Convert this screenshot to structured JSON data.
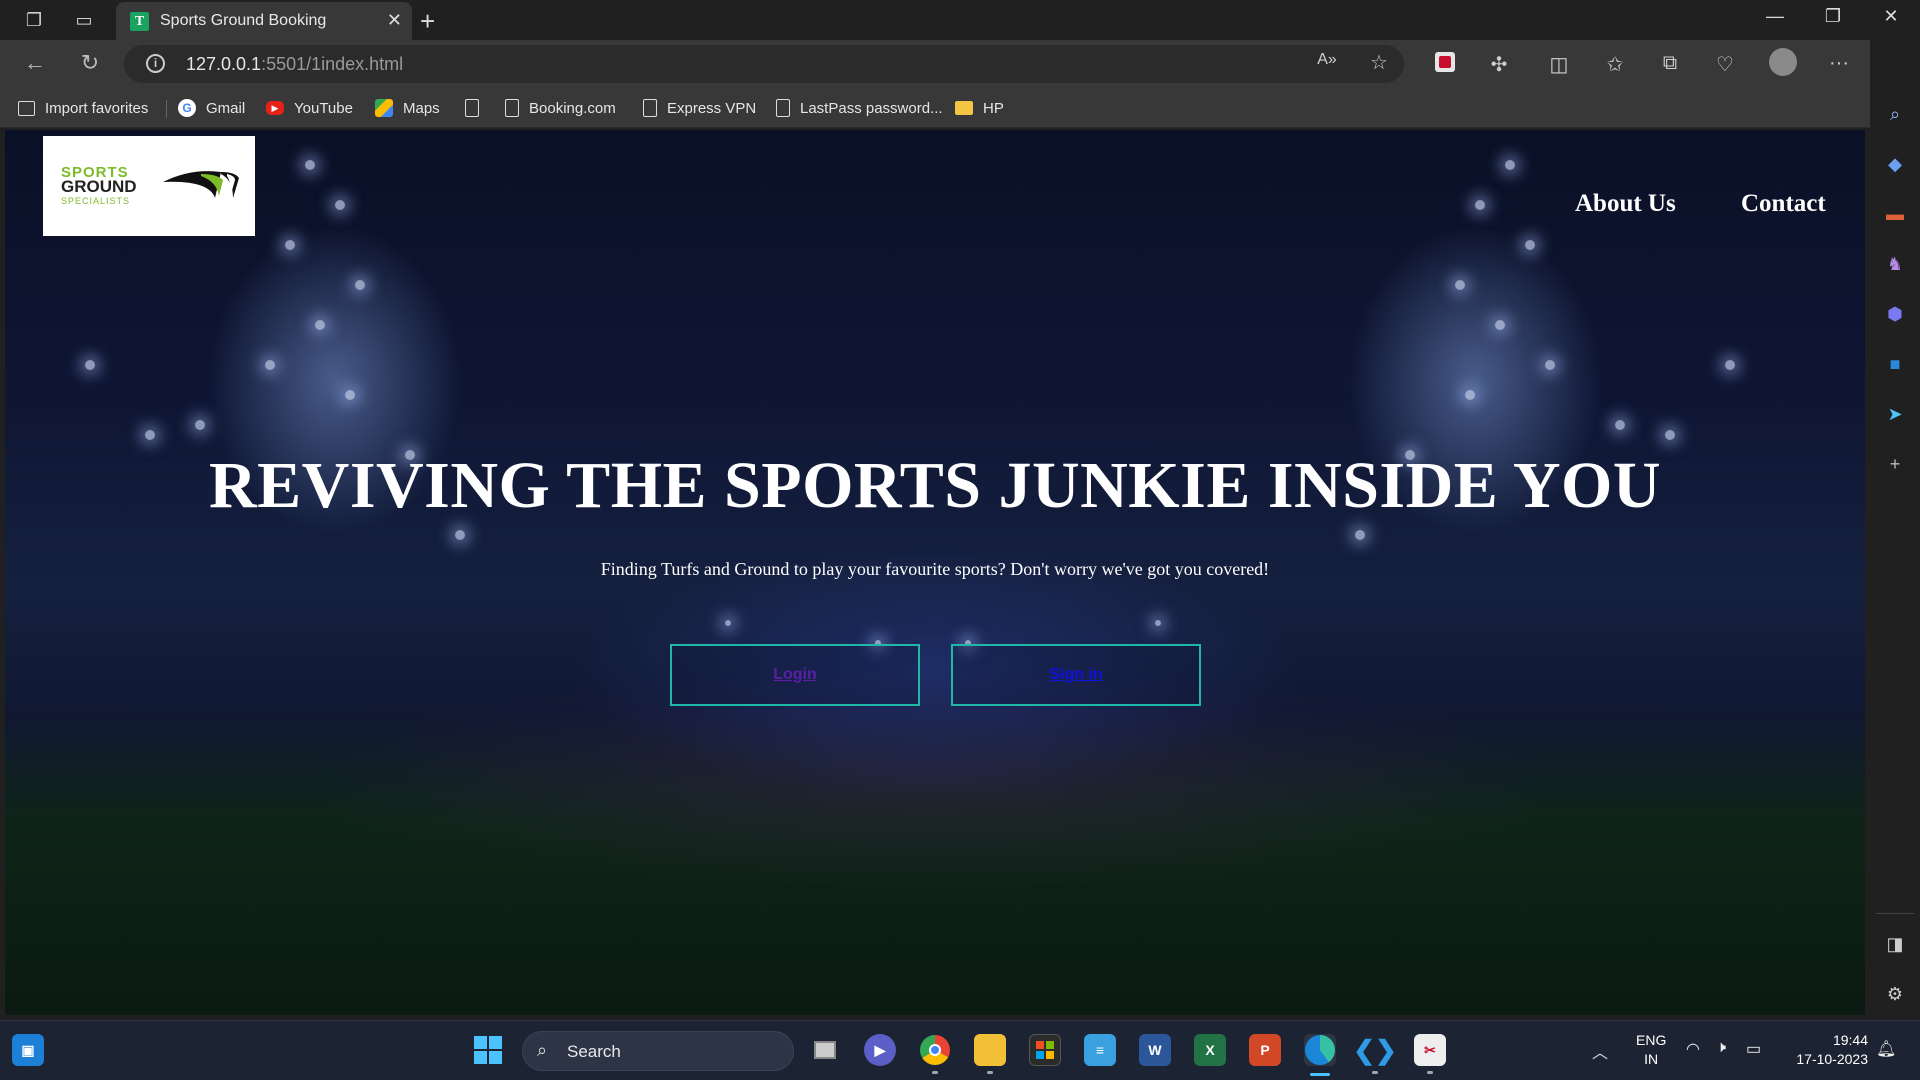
{
  "browser": {
    "tab_title": "Sports Ground Booking",
    "tab_favicon_letter": "T",
    "url_host": "127.0.0.1",
    "url_rest": ":5501/1index.html"
  },
  "favorites": [
    {
      "label": "Import favorites",
      "icon": "import-icon"
    },
    {
      "label": "Gmail",
      "icon": "google-icon"
    },
    {
      "label": "YouTube",
      "icon": "youtube-icon"
    },
    {
      "label": "Maps",
      "icon": "maps-icon"
    },
    {
      "label": "",
      "icon": "page-icon"
    },
    {
      "label": "Booking.com",
      "icon": "page-icon"
    },
    {
      "label": "Express VPN",
      "icon": "page-icon"
    },
    {
      "label": "LastPass password...",
      "icon": "page-icon"
    },
    {
      "label": "HP",
      "icon": "folder-icon"
    }
  ],
  "site": {
    "logo": {
      "line1": "SPORTS",
      "line2": "GROUND",
      "line3": "SPECIALISTS"
    },
    "nav": {
      "about": "About Us",
      "contact": "Contact"
    },
    "hero": {
      "title": "REVIVING THE SPORTS JUNKIE INSIDE YOU",
      "subtitle": "Finding Turfs and Ground to play your favourite sports? Don't worry we've got you covered!",
      "login_label": "Login",
      "signin_label": "Sign in"
    },
    "colors": {
      "button_border": "#1fb7a8",
      "login_link": "#5b1fa6",
      "signin_link": "#1010e0"
    }
  },
  "taskbar": {
    "search_label": "Search",
    "lang_line1": "ENG",
    "lang_line2": "IN",
    "time": "19:44",
    "date": "17-10-2023"
  }
}
